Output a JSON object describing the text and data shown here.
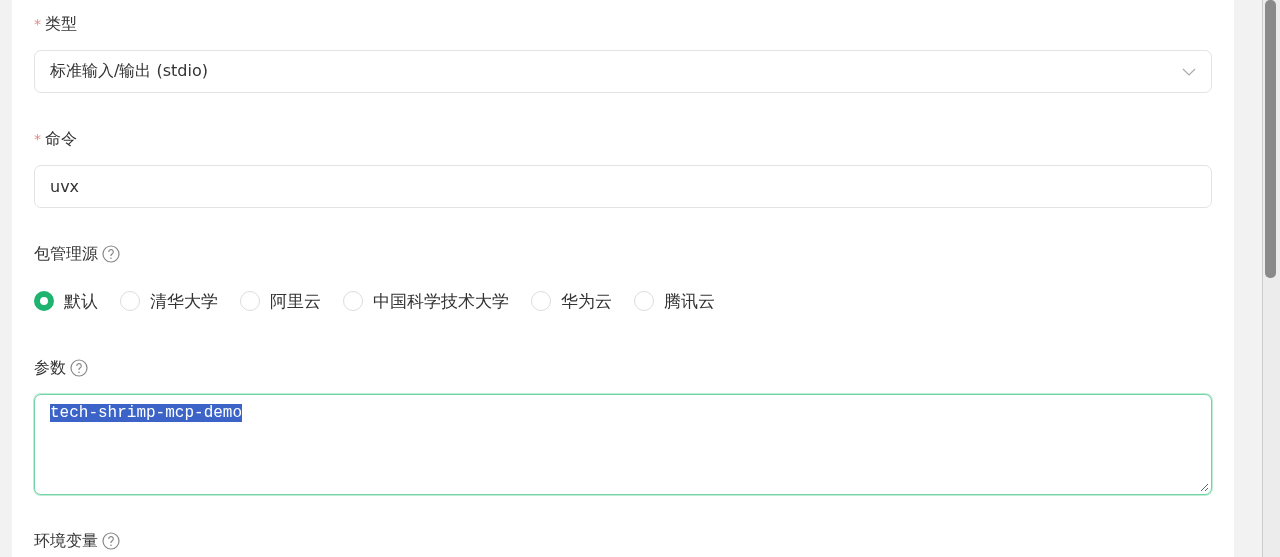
{
  "fields": [
    {
      "kind": "select",
      "label": "类型",
      "required_mark": "*",
      "value": "标准输入/输出 (stdio)"
    },
    {
      "kind": "input",
      "label": "命令",
      "required_mark": "*",
      "value": "uvx"
    },
    {
      "kind": "radio",
      "label": "包管理源",
      "help": true,
      "options": [
        {
          "label": "默认",
          "selected": true
        },
        {
          "label": "清华大学",
          "selected": false
        },
        {
          "label": "阿里云",
          "selected": false
        },
        {
          "label": "中国科学技术大学",
          "selected": false
        },
        {
          "label": "华为云",
          "selected": false
        },
        {
          "label": "腾讯云",
          "selected": false
        }
      ]
    },
    {
      "kind": "textarea",
      "label": "参数",
      "help": true,
      "focused": true,
      "text_selected": true,
      "value": "tech-shrimp-mcp-demo"
    },
    {
      "kind": "heading",
      "label": "环境变量",
      "help": true
    }
  ]
}
